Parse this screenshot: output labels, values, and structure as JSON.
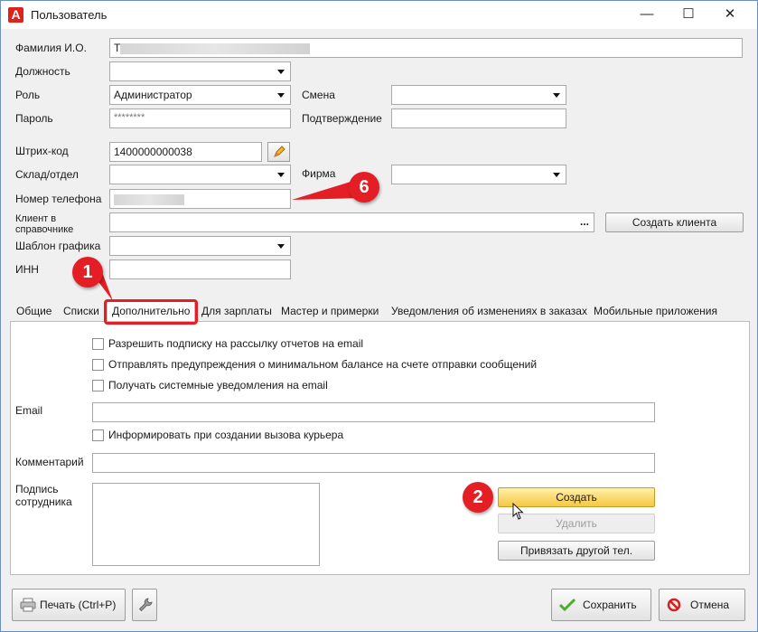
{
  "window": {
    "title": "Пользователь",
    "logo_letter": "A",
    "min_icon": "—",
    "max_icon": "☐",
    "close_icon": "✕"
  },
  "form": {
    "fio_label": "Фамилия И.О.",
    "fio_value": "Т",
    "position_label": "Должность",
    "role_label": "Роль",
    "role_value": "Администратор",
    "shift_label": "Смена",
    "password_label": "Пароль",
    "password_value": "********",
    "confirm_label": "Подтверждение",
    "barcode_label": "Штрих-код",
    "barcode_value": "1400000000038",
    "warehouse_label": "Склад/отдел",
    "firm_label": "Фирма",
    "phone_label": "Номер телефона",
    "client_label_line1": "Клиент в",
    "client_label_line2": "справочнике",
    "client_ellipsis": "...",
    "create_client_button": "Создать клиента",
    "schedule_label": "Шаблон графика",
    "inn_label": "ИНН"
  },
  "tabs": [
    {
      "label": "Общие"
    },
    {
      "label": "Списки"
    },
    {
      "label": "Дополнительно"
    },
    {
      "label": "Для зарплаты"
    },
    {
      "label": "Мастер и примерки"
    },
    {
      "label": "Уведомления об изменениях в заказах"
    },
    {
      "label": "Мобильные приложения"
    }
  ],
  "panel": {
    "check1": "Разрешить подписку на рассылку отчетов на email",
    "check2": "Отправлять предупреждения о минимальном балансе на счете отправки сообщений",
    "check3": "Получать системные уведомления на email",
    "email_label": "Email",
    "check4": "Информировать при создании вызова курьера",
    "comment_label": "Комментарий",
    "signature_label_line1": "Подпись",
    "signature_label_line2": "сотрудника",
    "create_button": "Создать",
    "delete_button": "Удалить",
    "bind_phone_button": "Привязать другой тел."
  },
  "annotations": {
    "badge1": "1",
    "badge2": "2",
    "badge6": "6",
    "color": "#e31e24"
  },
  "footer": {
    "print_button": "Печать (Ctrl+P)",
    "save_button": "Сохранить",
    "cancel_button": "Отмена"
  }
}
